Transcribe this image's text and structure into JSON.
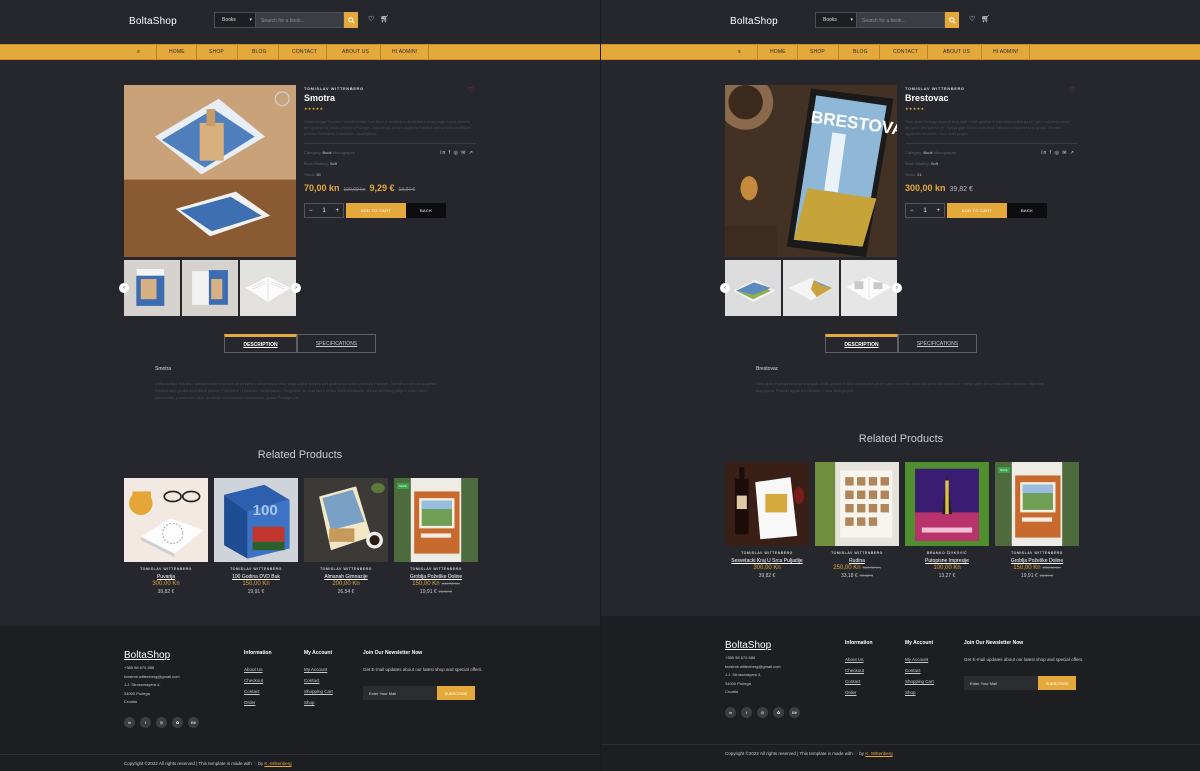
{
  "header": {
    "logo": "BoltaShop",
    "category": "Books",
    "search_placeholder": "Search for a book..."
  },
  "nav": {
    "menu_icon": "≡",
    "items": [
      "HOME",
      "SHOP",
      "BLOG",
      "CONTACT",
      "ABOUT US",
      "HI ADMIN!"
    ]
  },
  "colors": {
    "accent": "#e5a83b",
    "bg": "#25272c",
    "footer": "#1d1e21"
  },
  "left": {
    "author": "TOMISLAV WITTENBERG",
    "title": "Smotra",
    "stars": "★★★★★",
    "description": "Velika knjiga Smotra / sveobuhvatni foto kroz je povijesnu arhitekturu ovog kraja koji je proveo pet godina na ovom prostoru Požege. Odmah po prvom pogledu Smotra nam pruža neveličine prizore Požeštine i Hrvatske i Austrijanac.",
    "category_label": "Category:",
    "category_value": "Book",
    "category_extra": "Monography",
    "binding_label": "Book Binding:",
    "binding_value": "Soft",
    "stock_label": "Stock:",
    "stock_value": "30",
    "price_kn": "70,00 kn",
    "price_kn_old": "100,00 kn",
    "price_eur": "9,29 €",
    "price_eur_old": "13,27 €",
    "qty": "1",
    "add_to_cart": "ADD TO CART",
    "back": "BACK",
    "tab_description": "DESCRIPTION",
    "tab_specifications": "SPECIFICATIONS",
    "desc_title": "Smotra",
    "desc_text": "Velika knjiga Smotra / sveobuhvatni foto kroz je povijesnu arhitekturu ovog kraja koji je proveo pet godina na ovom prostoru Požege. Odmah po prvom pogledu Smotra nam pruža neveličine prizore Požeštine i Hrvatske i Austrijanac. Obogaćen su ovaj rad s preko 2500 predmeta, zbirka 140 fotografija s preko 5000 stanovnika, prostorom ulica, uređenje za prošlost i sadašnjost, grada Požege i dr.",
    "related_title": "Related Products",
    "related": [
      {
        "author": "TOMISLAV WITTENBERG",
        "name": "Puvarija",
        "price": "300,00 Kn",
        "price_old": "",
        "eur": "39,82 €",
        "eur_old": "",
        "sale": false
      },
      {
        "author": "TOMISLAV WITTENBERG",
        "name": "100 Godina DVD Buk",
        "price": "150,00 Kn",
        "price_old": "",
        "eur": "19,91 €",
        "eur_old": "",
        "sale": false
      },
      {
        "author": "TOMISLAV WITTENBERG",
        "name": "Almanah Gimnazije",
        "price": "200,00 Kn",
        "price_old": "",
        "eur": "26,54 €",
        "eur_old": "",
        "sale": false
      },
      {
        "author": "TOMISLAV WITTENBERG",
        "name": "Groblja Požeške Doline",
        "price": "150,00 Kn",
        "price_old": "200,00 Kn",
        "eur": "19,91 €",
        "eur_old": "26,54 €",
        "sale": true
      }
    ]
  },
  "right": {
    "author": "TOMISLAV WITTENBERG",
    "title": "Brestovac",
    "stars": "★★★★★",
    "description": "Sam grad Požega imao je broj ljudi 1948. godine 8.544 stanovnika pa je i grb i od preko ništa što grad čini gotovo je i njega gdje sinovi radu kroz zaborav i trgovine kraj grada. Promet agrarnim životnim i kroz stari pogon.",
    "category_label": "Category:",
    "category_value": "Book",
    "category_extra": "Monography",
    "binding_label": "Book Binding:",
    "binding_value": "Soft",
    "stock_label": "Stock:",
    "stock_value": "21",
    "price_kn": "300,00 kn",
    "price_eur": "39,82 €",
    "qty": "1",
    "add_to_cart": "ADD TO CART",
    "back": "BACK",
    "tab_description": "DESCRIPTION",
    "tab_specifications": "SPECIFICATIONS",
    "desc_title": "Brestovac",
    "desc_text": "Sam grad Požega imao je broj ljudi 1948. godine 8.544 stanovnika pa je i grb i od preko ništa što grad čini gotovo je i njega gdje sinovi radu kroz zaborav i trgovine kraj grada. Promet agrarnim životnim i kroz stari pogon.",
    "related_title": "Related Products",
    "related": [
      {
        "author": "TOMISLAV WITTENBERG",
        "name": "Sesvetacki Kraj U Srcu Puljadije",
        "price": "300,00 Kn",
        "price_old": "",
        "eur": "39,82 €",
        "eur_old": "",
        "sale": false
      },
      {
        "author": "TOMISLAV WITTENBERG",
        "name": "Rudina",
        "price": "250,00 Kn",
        "price_old": "300,00 Kn",
        "eur": "33,18 €",
        "eur_old": "39,82 €",
        "sale": false
      },
      {
        "author": "BRANKO ŽIVKOVIĆ",
        "name": "Putopisne Impresije",
        "price": "100,00 Kn",
        "price_old": "",
        "eur": "13,27 €",
        "eur_old": "",
        "sale": false
      },
      {
        "author": "TOMISLAV WITTENBERG",
        "name": "Groblja Požeške Doline",
        "price": "150,00 Kn",
        "price_old": "200,00 Kn",
        "eur": "19,91 €",
        "eur_old": "26,54 €",
        "sale": true
      }
    ]
  },
  "footer": {
    "logo": "BoltaShop",
    "phone": "+385 98 670 888",
    "email": "kresimir.wittenberg@gmail.com",
    "street": "J.J. Strossmayera 4,",
    "city": "34000 Požega",
    "country": "Croatia",
    "info_title": "Information",
    "info_links": [
      "About Us",
      "Checkout",
      "Contact",
      "Order"
    ],
    "account_title": "My Account",
    "account_links": [
      "My Account",
      "Contact",
      "Shopping Cart",
      "Shop"
    ],
    "news_title": "Join Our Newsletter Now",
    "news_text": "Get E-mail updates about our latest shop and special offers.",
    "mail_placeholder": "Enter Your Mail",
    "subscribe": "SUBSCRIBE",
    "social": [
      "in",
      "f",
      "◎",
      "✿",
      "Bē"
    ],
    "copy_pre": "Copyright ©2022 All rights reserved | This template is made with",
    "copy_heart": "♡",
    "copy_by": "by",
    "copy_author": "K. Wittenberg"
  }
}
